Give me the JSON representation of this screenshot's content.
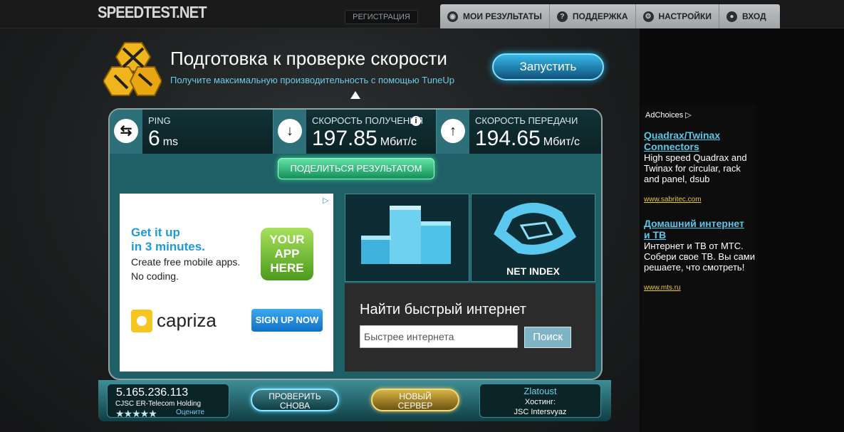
{
  "header": {
    "logo": "SPEEDTEST.NET",
    "register_label": "РЕГИСТРАЦИЯ",
    "nav": [
      {
        "label": "МОИ РЕЗУЛЬТАТЫ",
        "icon": "camera-icon"
      },
      {
        "label": "ПОДДЕРЖКА",
        "icon": "question-icon"
      },
      {
        "label": "НАСТРОЙКИ",
        "icon": "gear-icon"
      },
      {
        "label": "ВХОД",
        "icon": "user-icon"
      }
    ]
  },
  "promo": {
    "title": "Подготовка к проверке скорости",
    "subtitle": "Получите максимальную производительность с помощью TuneUp",
    "button": "Запустить"
  },
  "stats": {
    "ping": {
      "label": "PING",
      "value": "6",
      "unit": "ms"
    },
    "download": {
      "label": "СКОРОСТЬ ПОЛУЧЕНИЯ",
      "value": "197.85",
      "unit": "Мбит/с"
    },
    "upload": {
      "label": "СКОРОСТЬ ПЕРЕДАЧИ",
      "value": "194.65",
      "unit": "Мбит/с"
    }
  },
  "share_button": "ПОДЕЛИТЬСЯ РЕЗУЛЬТАТОМ",
  "ad": {
    "headline1": "Get it up",
    "headline2": "in 3 minutes.",
    "text1": "Create free mobile apps.",
    "text2": "No coding.",
    "badge": [
      "YOUR",
      "APP",
      "HERE"
    ],
    "logo": "capriza",
    "cta": "SIGN UP NOW"
  },
  "netindex_label": "NET INDEX",
  "find": {
    "title": "Найти быстрый интернет",
    "input_value": "Быстрее интернета",
    "button": "Поиск"
  },
  "footer": {
    "ip": "5.165.236.113",
    "isp": "CJSC ER-Telecom Holding",
    "rate_label": "Оцените",
    "retest": [
      "ПРОВЕРИТЬ",
      "СНОВА"
    ],
    "new_server": [
      "НОВЫЙ",
      "СЕРВЕР"
    ],
    "city": "Zlatoust",
    "host_label": "Хостинг:",
    "host": "JSC Intersvyaz"
  },
  "sidebar": {
    "adchoices": "AdChoices",
    "ads": [
      {
        "title": "Quadrax/Twinax Connectors",
        "text": "High speed Quadrax and Twinax for circular, rack and panel, dsub",
        "url": "www.sabritec.com"
      },
      {
        "title": "Домашний интернет и ТВ",
        "text": "Интернет и ТВ от МТС. Собери свое ТВ. Вы сами решаете, что смотреть!",
        "url": "www.mts.ru"
      }
    ]
  }
}
